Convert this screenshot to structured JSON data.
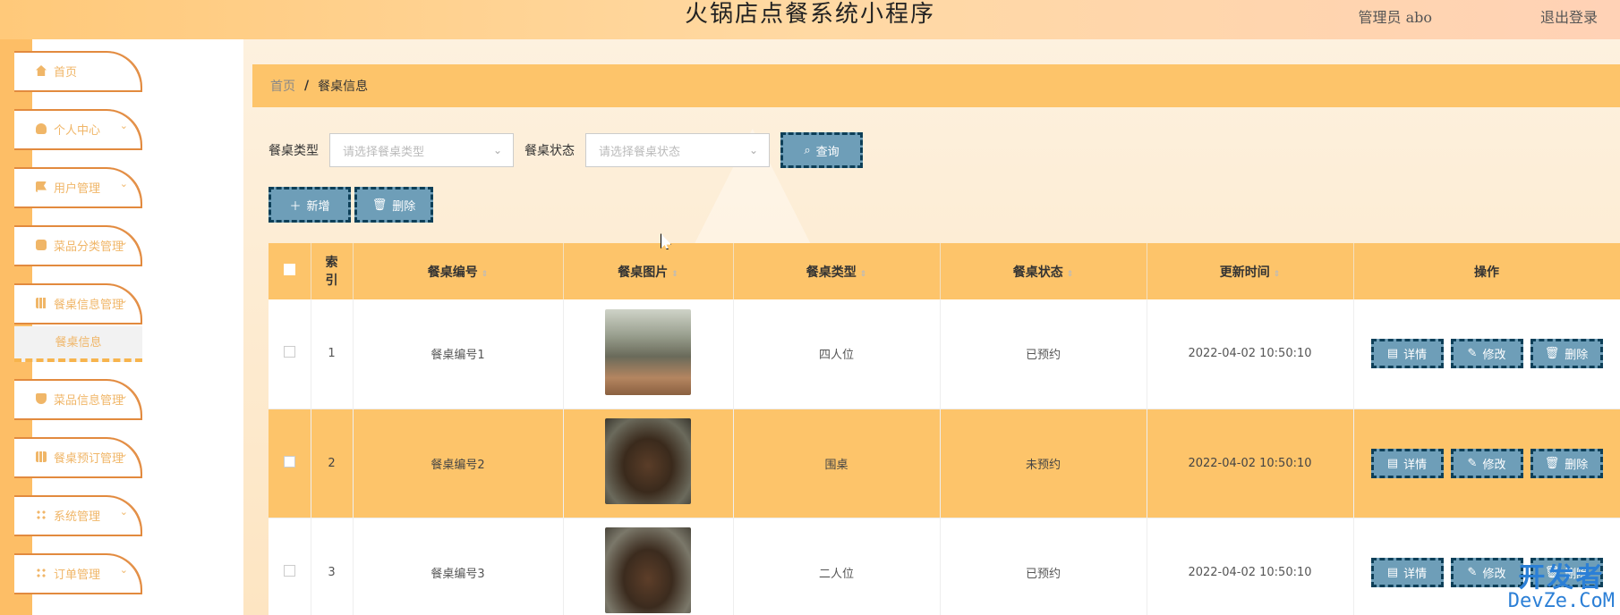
{
  "header": {
    "title": "火锅店点餐系统小程序",
    "user": "管理员 abo",
    "logout": "退出登录"
  },
  "sidebar": {
    "items": [
      {
        "label": "首页",
        "icon": "home-icon",
        "chevron": ""
      },
      {
        "label": "个人中心",
        "icon": "user-icon",
        "chevron": "⌄"
      },
      {
        "label": "用户管理",
        "icon": "flag-icon",
        "chevron": "⌄"
      },
      {
        "label": "菜品分类管理",
        "icon": "chat-icon",
        "chevron": "⌄"
      },
      {
        "label": "餐桌信息管理",
        "icon": "grid-icon",
        "chevron": "⌄"
      },
      {
        "label": "菜品信息管理",
        "icon": "shield-icon",
        "chevron": "⌄"
      },
      {
        "label": "餐桌预订管理",
        "icon": "bar-chart-icon",
        "chevron": "⌄"
      },
      {
        "label": "系统管理",
        "icon": "apps-icon",
        "chevron": "⌄"
      },
      {
        "label": "订单管理",
        "icon": "apps-icon",
        "chevron": "⌄"
      }
    ],
    "submenu_active": "餐桌信息"
  },
  "breadcrumb": {
    "home": "首页",
    "sep": "/",
    "current": "餐桌信息"
  },
  "filters": {
    "type_label": "餐桌类型",
    "type_placeholder": "请选择餐桌类型",
    "status_label": "餐桌状态",
    "status_placeholder": "请选择餐桌状态",
    "query_label": "查询"
  },
  "actions": {
    "add_label": "新增",
    "delete_label": "删除"
  },
  "table": {
    "headers": {
      "index": "索引",
      "number": "餐桌编号",
      "image": "餐桌图片",
      "type": "餐桌类型",
      "status": "餐桌状态",
      "updated": "更新时间",
      "ops": "操作"
    },
    "rows": [
      {
        "index": "1",
        "number": "餐桌编号1",
        "type": "四人位",
        "status": "已预约",
        "updated": "2022-04-02 10:50:10"
      },
      {
        "index": "2",
        "number": "餐桌编号2",
        "type": "围桌",
        "status": "未预约",
        "updated": "2022-04-02 10:50:10"
      },
      {
        "index": "3",
        "number": "餐桌编号3",
        "type": "二人位",
        "status": "已预约",
        "updated": "2022-04-02 10:50:10"
      }
    ],
    "row_buttons": {
      "detail": "详情",
      "edit": "修改",
      "delete": "删除"
    }
  },
  "watermark": {
    "top": "开发者",
    "bottom": "DevZe.CoM"
  },
  "colors": {
    "accent": "#fdc46a",
    "button": "#6e9eb8",
    "button_border": "#0d3f58",
    "sidebar_text": "#f0b668"
  }
}
